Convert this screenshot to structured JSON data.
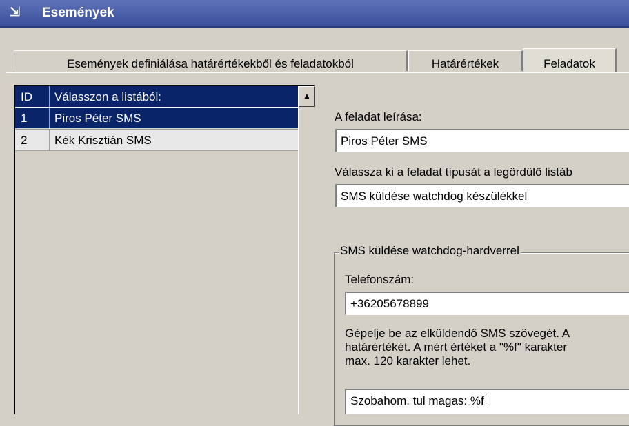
{
  "window": {
    "title": "Események"
  },
  "tabs": [
    {
      "label": "Események definiálása határértékekből és feladatokból"
    },
    {
      "label": "Határértékek"
    },
    {
      "label": "Feladatok"
    }
  ],
  "list": {
    "header": {
      "id": "ID",
      "name": "Válasszon a listából:"
    },
    "rows": [
      {
        "id": "1",
        "name": "Piros Péter SMS"
      },
      {
        "id": "2",
        "name": "Kék Krisztián SMS"
      }
    ]
  },
  "form": {
    "desc_label": "A feladat leírása:",
    "desc_value": "Piros Péter SMS",
    "type_label": "Válassza ki a feladat típusát a legördülő listáb",
    "type_value": "SMS küldése watchdog készülékkel",
    "group_title": "SMS küldése watchdog-hardverrel",
    "phone_label": "Telefonszám:",
    "phone_value": "+36205678899",
    "sms_help_lines": [
      "Gépelje be az elküldendő SMS szövegét. A",
      "határértékét. A mért értéket a \"%f\" karakter",
      "max. 120 karakter lehet."
    ],
    "sms_value": "Szobahom. tul magas: %f"
  }
}
